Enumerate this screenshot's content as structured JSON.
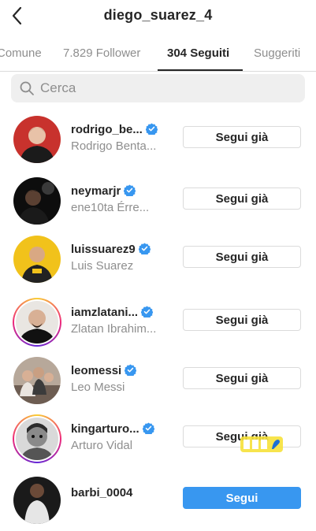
{
  "header": {
    "title": "diego_suarez_4",
    "back_icon": "chevron-left-icon"
  },
  "tabs": [
    {
      "label": "Comune",
      "active": false
    },
    {
      "label": "7.829 Follower",
      "active": false
    },
    {
      "label": "304 Seguiti",
      "active": true
    },
    {
      "label": "Suggeriti",
      "active": false
    }
  ],
  "search": {
    "placeholder": "Cerca",
    "icon": "search-icon"
  },
  "colors": {
    "accent": "#3897f0",
    "verified": "#3897f0",
    "muted_text": "#8e8e8e",
    "border": "#dbdbdb"
  },
  "following": [
    {
      "username": "rodrigo_be...",
      "full_name": "Rodrigo Benta...",
      "verified": true,
      "button": "Segui già",
      "story_ring": false
    },
    {
      "username": "neymarjr",
      "full_name": "ene10ta Érre...",
      "verified": true,
      "button": "Segui già",
      "story_ring": false
    },
    {
      "username": "luissuarez9",
      "full_name": "Luis Suarez",
      "verified": true,
      "button": "Segui già",
      "story_ring": false
    },
    {
      "username": "iamzlatani...",
      "full_name": "Zlatan Ibrahim...",
      "verified": true,
      "button": "Segui già",
      "story_ring": true
    },
    {
      "username": "leomessi",
      "full_name": "Leo Messi",
      "verified": true,
      "button": "Segui già",
      "story_ring": false
    },
    {
      "username": "kingarturo...",
      "full_name": "Arturo Vidal",
      "verified": true,
      "button": "Segui già",
      "story_ring": true
    },
    {
      "username": "barbi_0004",
      "full_name": "",
      "verified": false,
      "button": "Segui",
      "story_ring": false
    }
  ]
}
